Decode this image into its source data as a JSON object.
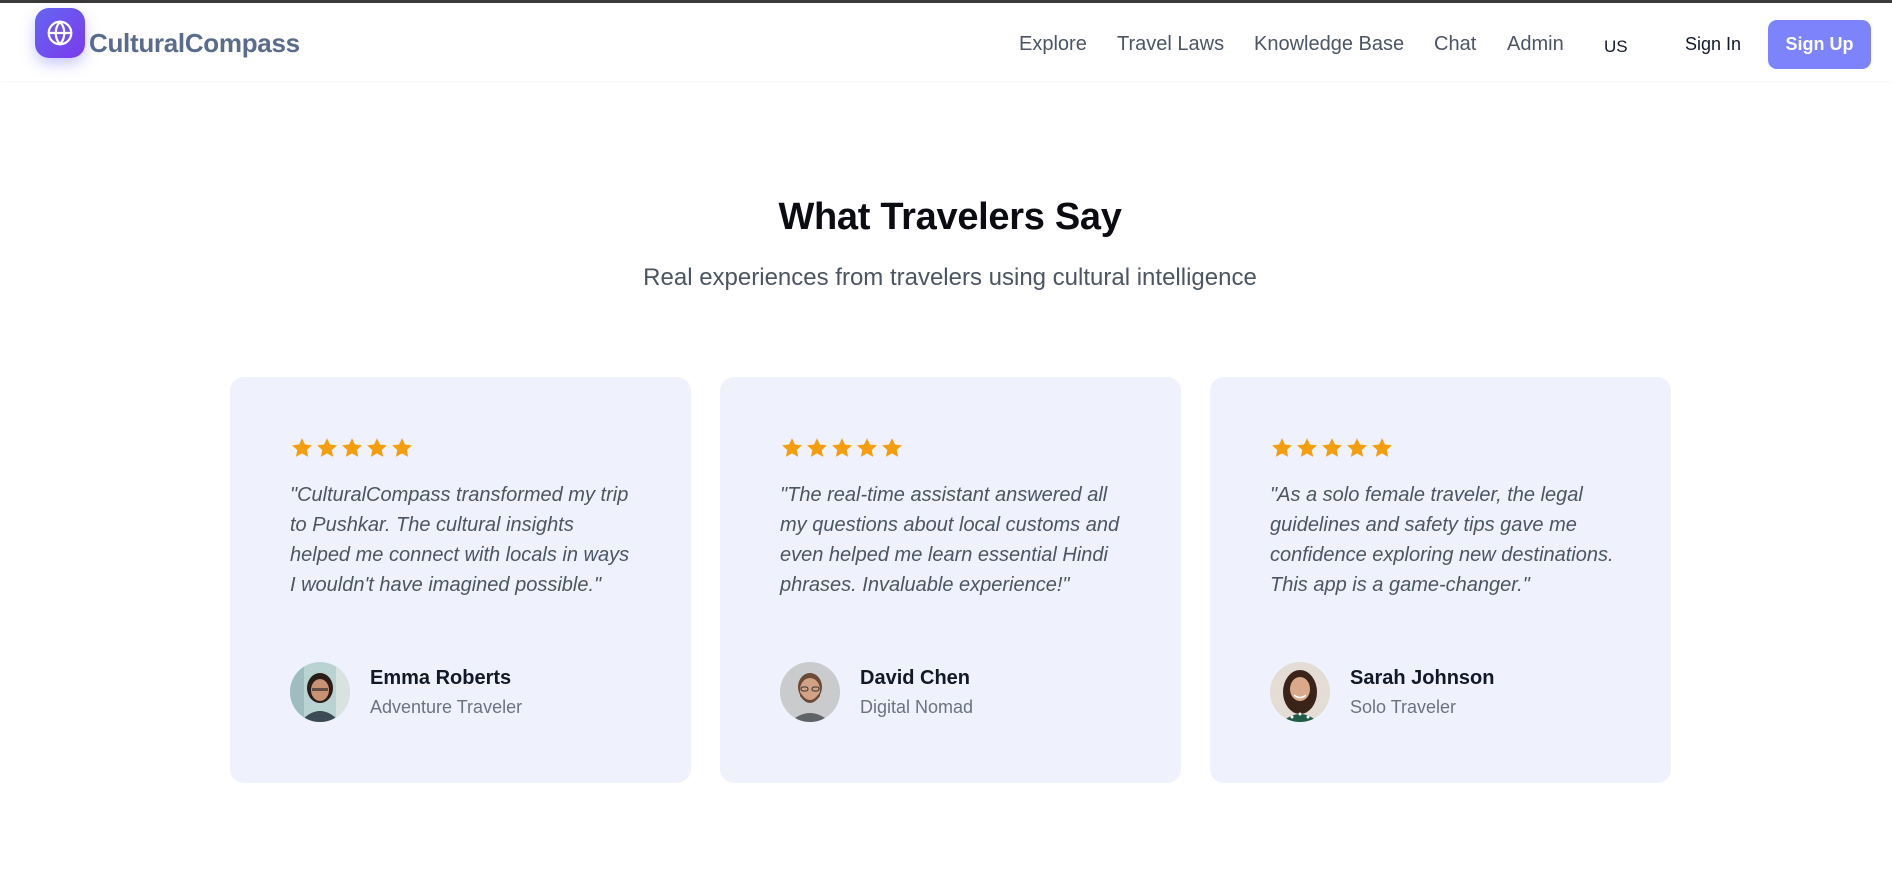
{
  "header": {
    "brand": "CulturalCompass",
    "logo_icon": "globe-icon",
    "nav_items": [
      {
        "label": "Explore"
      },
      {
        "label": "Travel Laws"
      },
      {
        "label": "Knowledge Base"
      },
      {
        "label": "Chat"
      },
      {
        "label": "Admin"
      }
    ],
    "language": "US",
    "sign_in": "Sign In",
    "sign_up": "Sign Up"
  },
  "section": {
    "title": "What Travelers Say",
    "subtitle": "Real experiences from travelers using cultural intelligence"
  },
  "testimonials": [
    {
      "rating": 5,
      "quote": "\"CulturalCompass transformed my trip to Pushkar. The cultural insights helped me connect with locals in ways I wouldn't have imagined possible.\"",
      "name": "Emma Roberts",
      "role": "Adventure Traveler"
    },
    {
      "rating": 5,
      "quote": "\"The real-time assistant answered all my questions about local customs and even helped me learn essential Hindi phrases. Invaluable experience!\"",
      "name": "David Chen",
      "role": "Digital Nomad"
    },
    {
      "rating": 5,
      "quote": "\"As a solo female traveler, the legal guidelines and safety tips gave me confidence exploring new destinations. This app is a game-changer.\"",
      "name": "Sarah Johnson",
      "role": "Solo Traveler"
    }
  ],
  "colors": {
    "accent": "#7c83fb",
    "logo_gradient_start": "#6366f1",
    "logo_gradient_end": "#7c3aed",
    "star": "#f59e0b",
    "card_bg": "#eff1fd"
  }
}
